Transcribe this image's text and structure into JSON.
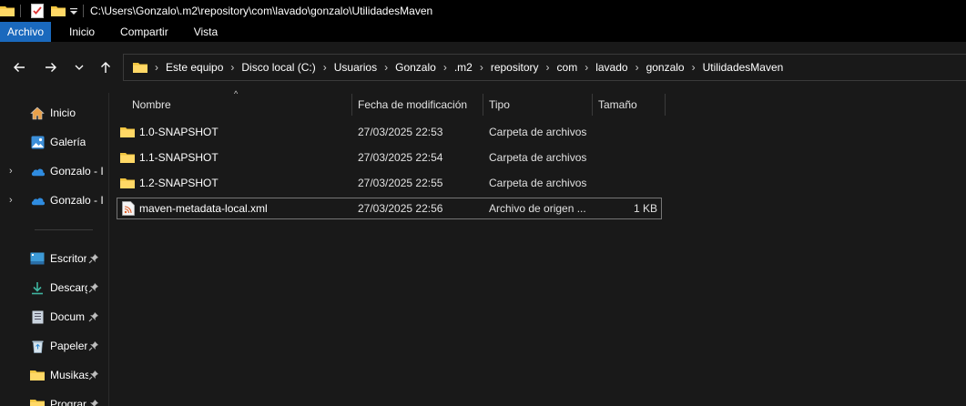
{
  "window": {
    "title_path": "C:\\Users\\Gonzalo\\.m2\\repository\\com\\lavado\\gonzalo\\UtilidadesMaven"
  },
  "ribbon": {
    "tabs": [
      {
        "label": "Archivo",
        "active": true
      },
      {
        "label": "Inicio",
        "active": false
      },
      {
        "label": "Compartir",
        "active": false
      },
      {
        "label": "Vista",
        "active": false
      }
    ]
  },
  "breadcrumb": [
    "Este equipo",
    "Disco local (C:)",
    "Usuarios",
    "Gonzalo",
    ".m2",
    "repository",
    "com",
    "lavado",
    "gonzalo",
    "UtilidadesMaven"
  ],
  "navpane": {
    "items": [
      {
        "label": "Inicio",
        "icon": "home-icon",
        "chevron": false,
        "pinned": false
      },
      {
        "label": "Galería",
        "icon": "gallery-icon",
        "chevron": false,
        "pinned": false
      },
      {
        "label": "Gonzalo - I",
        "icon": "onedrive-icon",
        "chevron": true,
        "pinned": false
      },
      {
        "label": "Gonzalo - I",
        "icon": "onedrive-icon",
        "chevron": true,
        "pinned": false
      },
      {
        "label": "Escritor",
        "icon": "desktop-icon",
        "chevron": false,
        "pinned": true
      },
      {
        "label": "Descarg",
        "icon": "download-icon",
        "chevron": false,
        "pinned": true
      },
      {
        "label": "Docum",
        "icon": "documents-icon",
        "chevron": false,
        "pinned": true
      },
      {
        "label": "Papeler",
        "icon": "recycle-bin-icon",
        "chevron": false,
        "pinned": true
      },
      {
        "label": "Musikas",
        "icon": "folder-icon",
        "chevron": false,
        "pinned": true
      },
      {
        "label": "Prograr",
        "icon": "folder-icon",
        "chevron": false,
        "pinned": true
      }
    ]
  },
  "columns": {
    "name": "Nombre",
    "date": "Fecha de modificación",
    "type": "Tipo",
    "size": "Tamaño"
  },
  "files": [
    {
      "name": "1.0-SNAPSHOT",
      "date": "27/03/2025 22:53",
      "type": "Carpeta de archivos",
      "size": "",
      "icon": "folder-icon"
    },
    {
      "name": "1.1-SNAPSHOT",
      "date": "27/03/2025 22:54",
      "type": "Carpeta de archivos",
      "size": "",
      "icon": "folder-icon"
    },
    {
      "name": "1.2-SNAPSHOT",
      "date": "27/03/2025 22:55",
      "type": "Carpeta de archivos",
      "size": "",
      "icon": "folder-icon"
    },
    {
      "name": "maven-metadata-local.xml",
      "date": "27/03/2025 22:56",
      "type": "Archivo de origen ...",
      "size": "1 KB",
      "icon": "xml-file-icon"
    }
  ],
  "colors": {
    "accent": "#1a69bd",
    "folder": "#f0c43f",
    "background": "#191919"
  }
}
